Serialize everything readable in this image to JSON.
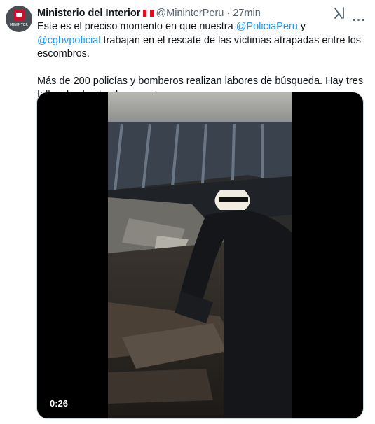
{
  "author": {
    "name": "Ministerio del Interior",
    "handle": "@MininterPeru",
    "separator": "·",
    "time": "27min",
    "avatar_label": "MININTER"
  },
  "tweet": {
    "line1_before": "Este es el preciso momento en que nuestra ",
    "mention1": "@PoliciaPeru",
    "line1_middle": " y ",
    "mention2": "@cgbvpoficial",
    "line1_after": " trabajan en el rescate de las víctimas atrapadas entre los escombros.",
    "paragraph2": "Más de 200 policías y bomberos realizan labores de búsqueda. Hay tres fallecidos hasta el momento."
  },
  "media": {
    "duration": "0:26"
  },
  "colors": {
    "text": "#0f1419",
    "muted": "#536471",
    "link": "#1d9bf0",
    "border": "#cfd9de",
    "flag_red": "#d91023"
  },
  "icons": {
    "flag": "peru-flag-icon",
    "grok": "grok-icon",
    "more": "more-options-icon"
  }
}
